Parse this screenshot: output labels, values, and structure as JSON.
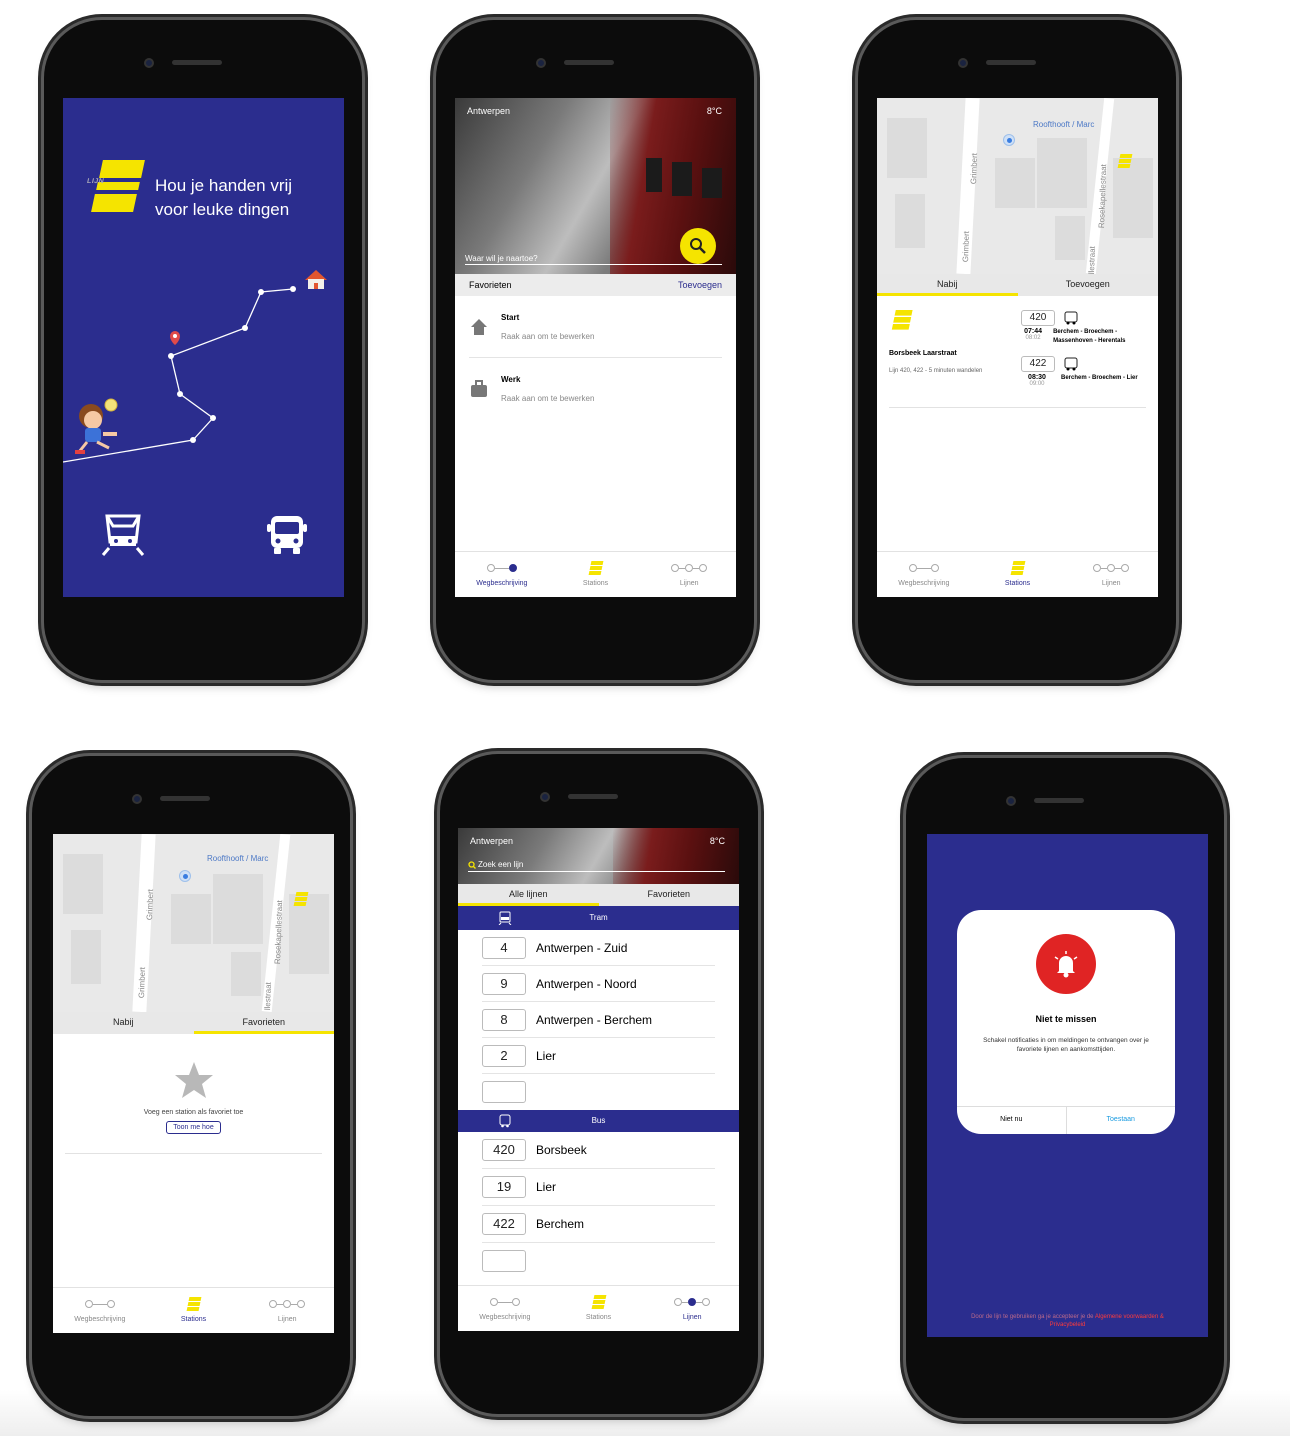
{
  "phone1": {
    "logo_text": "LIJN",
    "tagline_line1": "Hou je handen vrij",
    "tagline_line2": "voor leuke dingen",
    "tram_label": "tram-icon",
    "bus_label": "bus-icon"
  },
  "phone2": {
    "city": "Antwerpen",
    "temp": "8°C",
    "search_placeholder": "Waar wil je naartoe?",
    "favorites_title": "Favorieten",
    "add_label": "Toevoegen",
    "favorites": [
      {
        "title": "Start",
        "subtitle": "Raak aan om te bewerken",
        "icon": "home-icon"
      },
      {
        "title": "Werk",
        "subtitle": "Raak aan om te bewerken",
        "icon": "briefcase-icon"
      }
    ],
    "tabs": [
      "Wegbeschrijving",
      "Stations",
      "Lijnen"
    ]
  },
  "phone3": {
    "map": {
      "poi": "Roofthooft / Marc",
      "street1": "Grimbert",
      "street2": "Rosekapellestraat",
      "street3": "Grimbert",
      "street4": "llestraat"
    },
    "seg": [
      "Nabij",
      "Toevoegen"
    ],
    "stop_name": "Borsbeek Laarstraat",
    "stop_info": "Lijn 420, 422 - 5 minuten wandelen",
    "departures": [
      {
        "line": "420",
        "time": "07:44",
        "sched": "08:02",
        "dest": "Berchem - Broechem - Massenhoven - Herentals"
      },
      {
        "line": "422",
        "time": "08:30",
        "sched": "09:00",
        "dest": "Berchem - Broechem - Lier"
      }
    ],
    "tabs": [
      "Wegbeschrijving",
      "Stations",
      "Lijnen"
    ]
  },
  "phone4": {
    "map": {
      "poi": "Roofthooft / Marc",
      "street1": "Grimbert",
      "street2": "Rosekapellestraat",
      "street3": "Grimbert",
      "street4": "llestraat"
    },
    "seg": [
      "Nabij",
      "Favorieten"
    ],
    "empty_text": "Voeg een station als favoriet toe",
    "show_button": "Toon me hoe",
    "tabs": [
      "Wegbeschrijving",
      "Stations",
      "Lijnen"
    ]
  },
  "phone5": {
    "city": "Antwerpen",
    "temp": "8°C",
    "search_placeholder": "Zoek een lijn",
    "seg": [
      "Alle lijnen",
      "Favorieten"
    ],
    "tram_header": "Tram",
    "bus_header": "Bus",
    "tram_lines": [
      {
        "num": "4",
        "name": "Antwerpen - Zuid"
      },
      {
        "num": "9",
        "name": "Antwerpen - Noord"
      },
      {
        "num": "8",
        "name": "Antwerpen - Berchem"
      },
      {
        "num": "2",
        "name": "Lier"
      }
    ],
    "bus_lines": [
      {
        "num": "420",
        "name": "Borsbeek"
      },
      {
        "num": "19",
        "name": "Lier"
      },
      {
        "num": "422",
        "name": "Berchem"
      }
    ],
    "tabs": [
      "Wegbeschrijving",
      "Stations",
      "Lijnen"
    ]
  },
  "phone6": {
    "title": "Niet te missen",
    "body": "Schakel notificaties in om meldingen te ontvangen over je favoriete lijnen en aankomsttijden.",
    "btn_no": "Niet nu",
    "btn_yes": "Toestaan",
    "footer_prefix": "Door de lijn te gebruiken ga je accepteer je de",
    "footer_link": "Algemene voorwaarden & Privacybeleid"
  },
  "colors": {
    "brand_blue": "#2b2d8e",
    "brand_yellow": "#f5e400",
    "alert_red": "#e02424",
    "link_blue": "#1a9be0"
  }
}
